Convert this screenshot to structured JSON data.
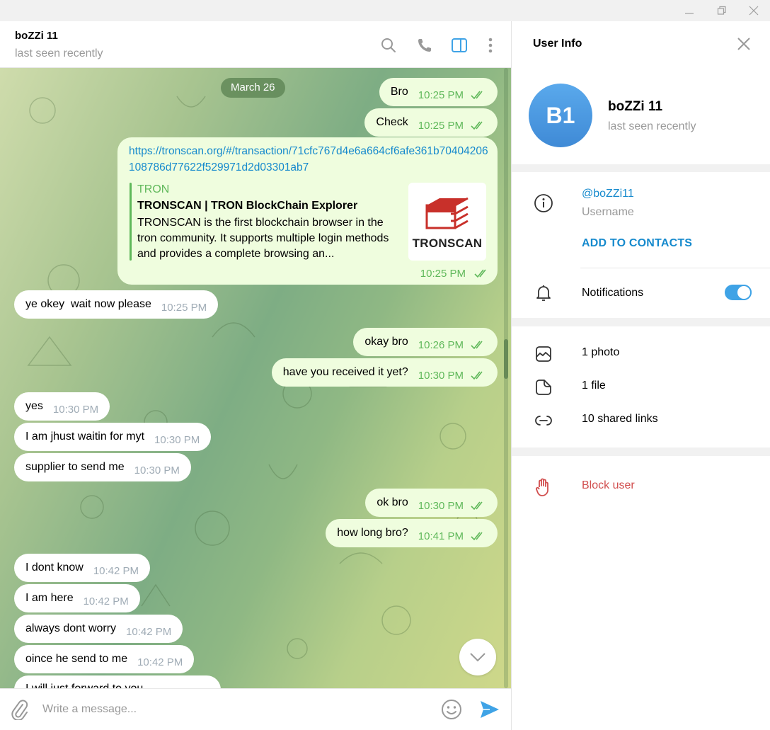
{
  "window": {
    "controls": [
      "minimize-icon",
      "restore-icon",
      "close-icon"
    ]
  },
  "chat_header": {
    "title": "boZZi 11",
    "status": "last seen recently",
    "icons": [
      "search-icon",
      "phone-icon",
      "sidebar-toggle-icon",
      "more-vertical-icon"
    ]
  },
  "chat": {
    "date_separator": "March 26",
    "messages": [
      {
        "dir": "out",
        "text": "Bro",
        "time": "10:25 PM",
        "read": true
      },
      {
        "dir": "out",
        "text": "Check",
        "time": "10:25 PM",
        "read": true
      },
      {
        "dir": "out",
        "type": "link",
        "url": "https://tronscan.org/#/transaction/71cfc767d4e6a664cf6afe361b70404206108786d77622f529971d2d03301ab7",
        "preview": {
          "site": "TRON",
          "title": "TRONSCAN | TRON BlockChain Explorer",
          "description": "TRONSCAN is the first blockchain browser in the tron community. It supports multiple login methods and provides a complete browsing an...",
          "image_label": "TRONSCAN"
        },
        "time": "10:25 PM",
        "read": true
      },
      {
        "dir": "in",
        "text": "ye okey  wait now please",
        "time": "10:25 PM"
      },
      {
        "dir": "out",
        "text": "okay bro",
        "time": "10:26 PM",
        "read": true
      },
      {
        "dir": "out",
        "text": "have you received it yet?",
        "time": "10:30 PM",
        "read": true
      },
      {
        "dir": "in",
        "text": "yes",
        "time": "10:30 PM"
      },
      {
        "dir": "in",
        "text": "I am jhust waitin for myt",
        "time": "10:30 PM"
      },
      {
        "dir": "in",
        "text": "supplier to send me",
        "time": "10:30 PM"
      },
      {
        "dir": "out",
        "text": "ok bro",
        "time": "10:30 PM",
        "read": true
      },
      {
        "dir": "out",
        "text": "how long bro?",
        "time": "10:41 PM",
        "read": true
      },
      {
        "dir": "in",
        "text": "I dont know",
        "time": "10:42 PM"
      },
      {
        "dir": "in",
        "text": "I am here",
        "time": "10:42 PM"
      },
      {
        "dir": "in",
        "text": "always dont worry",
        "time": "10:42 PM"
      },
      {
        "dir": "in",
        "text": "oince he send to me",
        "time": "10:42 PM"
      },
      {
        "dir": "in",
        "text": "I will just forward to you",
        "time": ""
      }
    ]
  },
  "composer": {
    "placeholder": "Write a message...",
    "value": ""
  },
  "user_info": {
    "title": "User Info",
    "avatar_initials": "B1",
    "avatar_color": "#4a9be4",
    "name": "boZZi 11",
    "status": "last seen recently",
    "username": "@boZZi11",
    "username_label": "Username",
    "add_contacts": "ADD TO CONTACTS",
    "notifications_label": "Notifications",
    "notifications_on": true,
    "media": [
      {
        "icon": "photo-icon",
        "label": "1 photo"
      },
      {
        "icon": "file-icon",
        "label": "1 file"
      },
      {
        "icon": "link-icon",
        "label": "10 shared links"
      }
    ],
    "block_label": "Block user"
  },
  "colors": {
    "accent": "#168acd",
    "outgoing_bubble": "#effdde",
    "outgoing_time": "#5fb85a",
    "danger": "#d14e4e",
    "toggle": "#3fa3e6"
  }
}
